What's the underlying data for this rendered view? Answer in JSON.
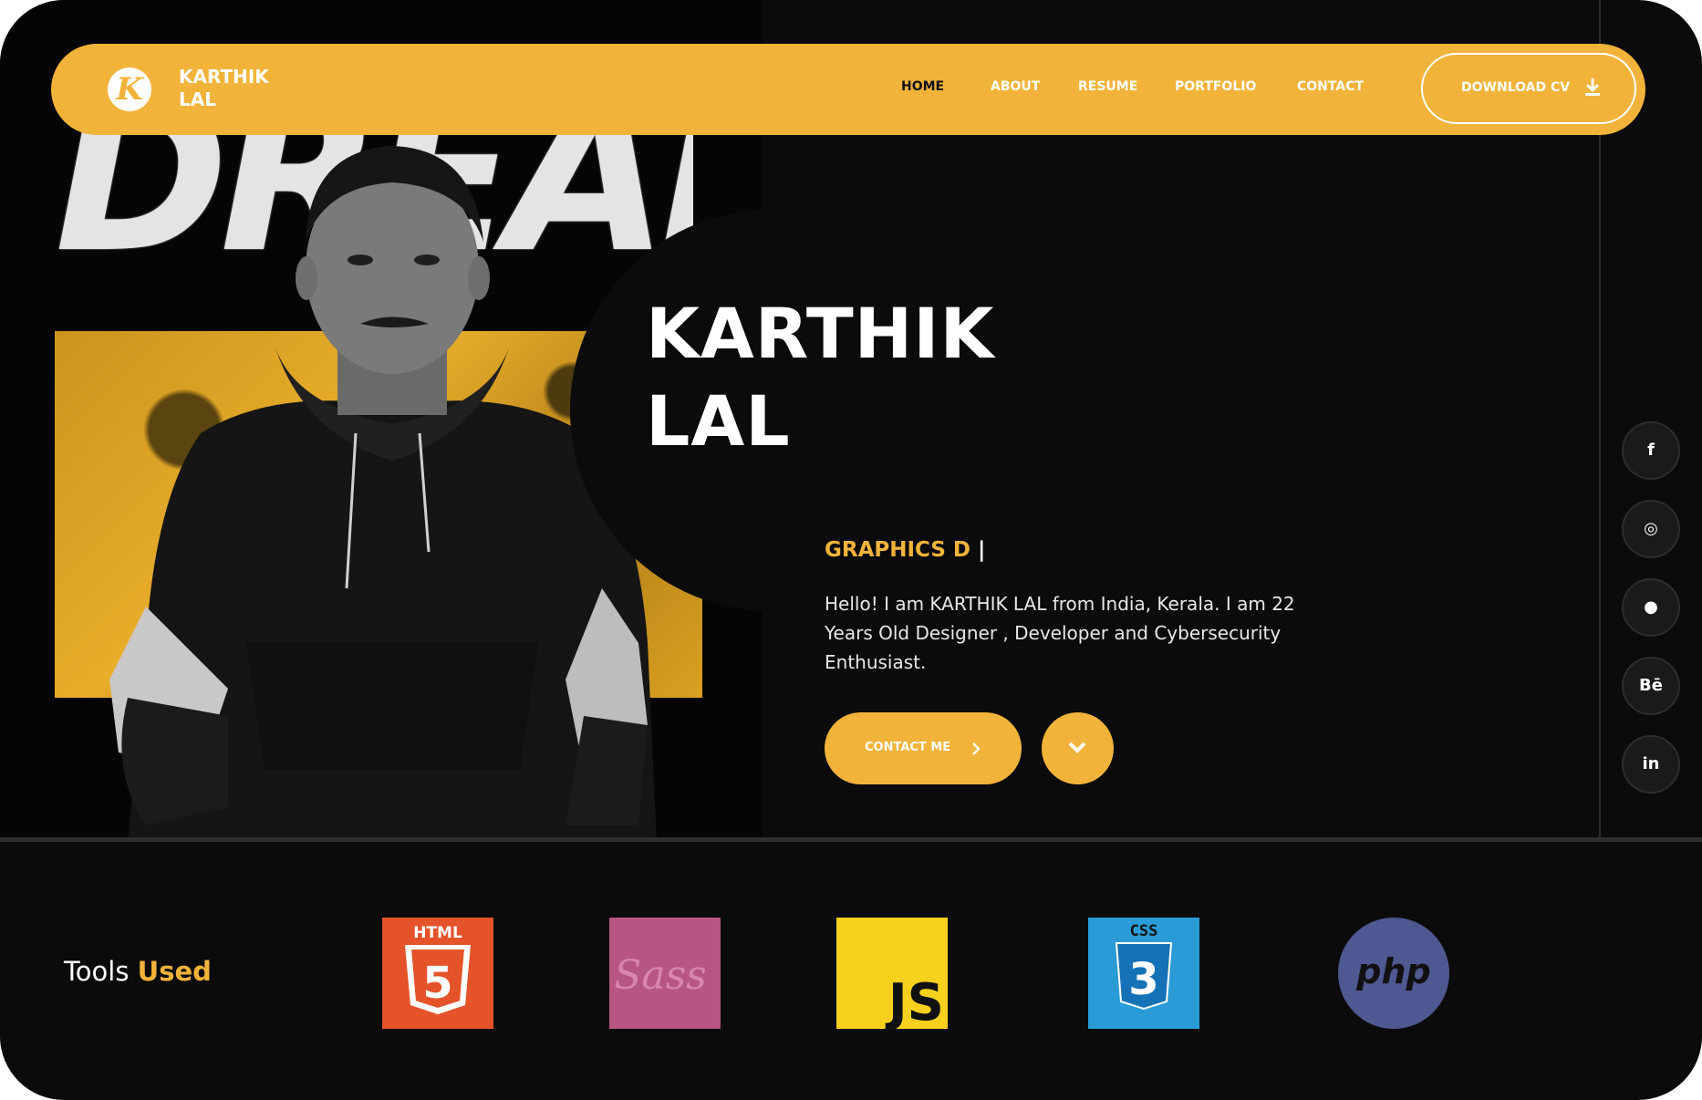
{
  "nav": {
    "brand_line1": "KARTHIK",
    "brand_line2": "LAL",
    "logo_letter": "K",
    "links": [
      "HOME",
      "ABOUT",
      "RESUME",
      "PORTFOLIO",
      "CONTACT"
    ],
    "active": "HOME",
    "download_label": "DOWNLOAD CV"
  },
  "hero": {
    "background_word": "DREAM",
    "name_line1": "KARTHIK",
    "name_line2": "LAL",
    "role": "GRAPHICS D",
    "caret": "|",
    "bio": "Hello! I am KARTHIK LAL from India, Kerala. I am 22 Years Old Designer , Developer and Cybersecurity Enthusiast.",
    "contact_label": "CONTACT ME"
  },
  "social": [
    {
      "icon": "facebook-icon",
      "glyph": "f"
    },
    {
      "icon": "instagram-icon",
      "glyph": "◎"
    },
    {
      "icon": "github-icon",
      "glyph": "●"
    },
    {
      "icon": "behance-icon",
      "glyph": "Bē"
    },
    {
      "icon": "linkedin-icon",
      "glyph": "in"
    }
  ],
  "tools": {
    "title_plain": "Tools",
    "title_highlight": "Used",
    "items": [
      {
        "name": "HTML",
        "text": "5",
        "color": "#e4532a"
      },
      {
        "name": "Sass",
        "text": "Sass",
        "color": "#b75683"
      },
      {
        "name": "JS",
        "text": "JS",
        "color": "#f7d11e"
      },
      {
        "name": "CSS",
        "text": "3",
        "color": "#2a9bd6"
      },
      {
        "name": "php",
        "text": "php",
        "color": "#4e5891"
      }
    ]
  },
  "colors": {
    "accent": "#f2b33a",
    "background": "#0b0b0b"
  }
}
